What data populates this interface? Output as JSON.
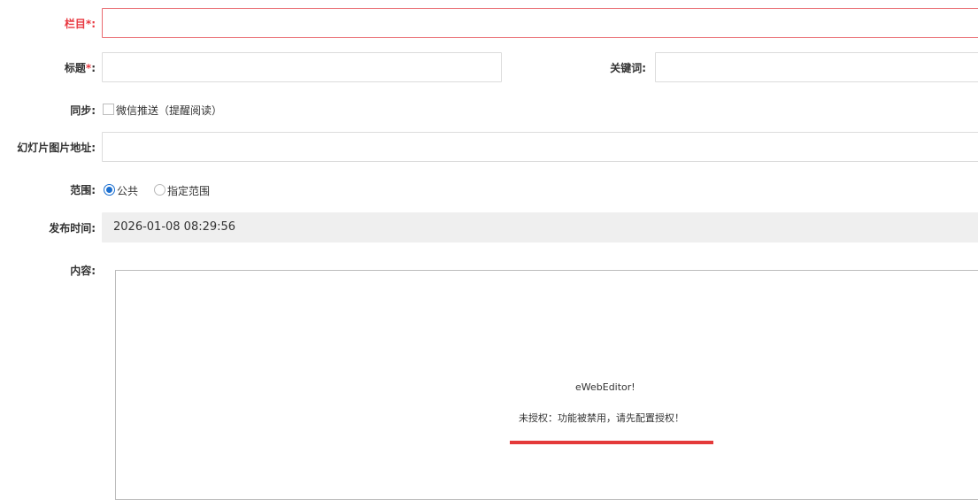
{
  "form": {
    "column": {
      "label": "栏目",
      "required_mark": "*",
      "colon": ":",
      "value": ""
    },
    "title": {
      "label": "标题",
      "required_mark": "*",
      "colon": ":",
      "value": ""
    },
    "keywords": {
      "label": "关键词:",
      "value": ""
    },
    "sync": {
      "label": "同步:",
      "option_label": "微信推送（提醒阅读）",
      "checked": false
    },
    "slide_image": {
      "label": "幻灯片图片地址:",
      "value": ""
    },
    "scope": {
      "label": "范围:",
      "options": [
        {
          "label": "公共",
          "checked": true
        },
        {
          "label": "指定范围",
          "checked": false
        }
      ]
    },
    "publish_time": {
      "label": "发布时间:",
      "value": "2026-01-08 08:29:56"
    },
    "content": {
      "label": "内容:",
      "editor_name": "eWebEditor!",
      "editor_message": "未授权：功能被禁用，请先配置授权！",
      "accent_color": "#e43a3a"
    }
  },
  "colors": {
    "required": "#e8373f",
    "error_border": "#e96a70",
    "radio_checked": "#1b6fd0",
    "readonly_bg": "#efefef"
  }
}
